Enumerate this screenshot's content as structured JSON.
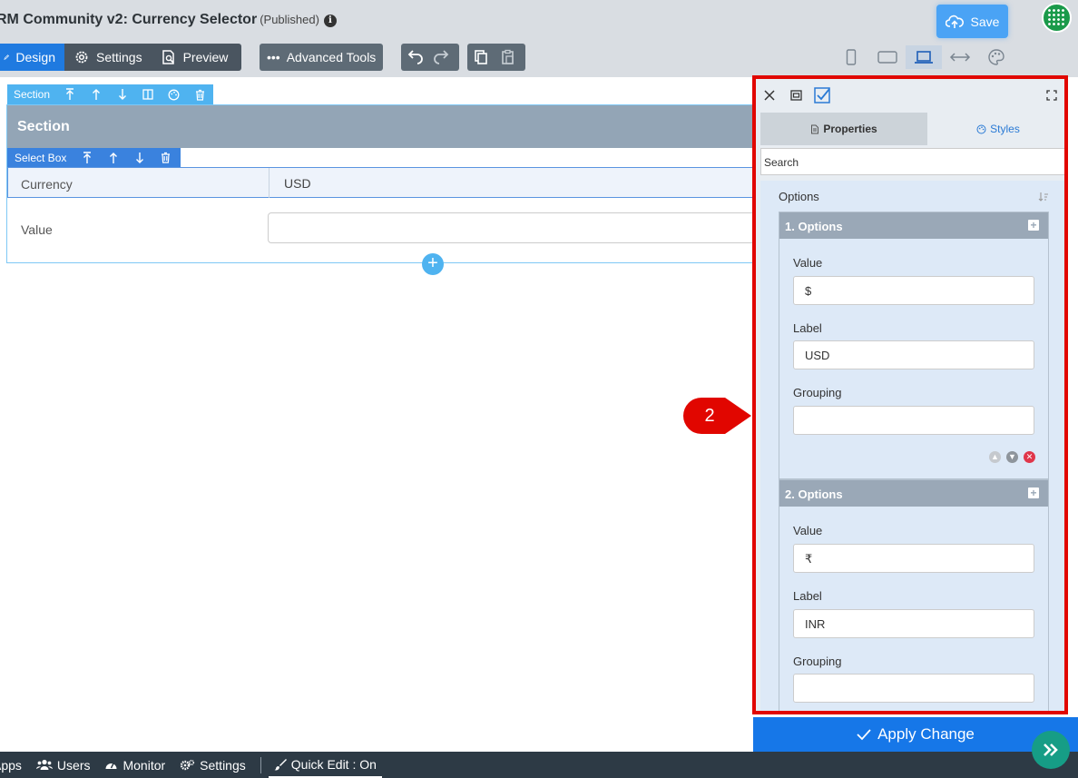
{
  "header": {
    "title": "RM Community v2: Currency Selector",
    "status": "(Published)",
    "info_glyph": "i",
    "save_label": "Save"
  },
  "toolbar": {
    "design": "Design",
    "settings": "Settings",
    "preview": "Preview",
    "advanced_tools": "Advanced Tools"
  },
  "canvas": {
    "section_toolbar_label": "Section",
    "section_title": "Section",
    "selectbox_toolbar_label": "Select Box",
    "currency_label": "Currency",
    "currency_value": "USD",
    "value_label": "Value"
  },
  "annotation": {
    "marker_number": "2",
    "color": "#e10600"
  },
  "panel": {
    "tab_properties": "Properties",
    "tab_styles": "Styles",
    "search_placeholder": "Search",
    "options_title": "Options",
    "options": [
      {
        "header": "1. Options",
        "value_label": "Value",
        "value": "$",
        "label_label": "Label",
        "label": "USD",
        "grouping_label": "Grouping",
        "grouping": ""
      },
      {
        "header": "2. Options",
        "value_label": "Value",
        "value": "₹",
        "label_label": "Label",
        "label": "INR",
        "grouping_label": "Grouping",
        "grouping": ""
      }
    ]
  },
  "apply_label": "Apply Change",
  "footer": {
    "apps": "Apps",
    "users": "Users",
    "monitor": "Monitor",
    "settings": "Settings",
    "quick_edit": "Quick Edit : On"
  },
  "colors": {
    "primary": "#1f7ae0",
    "accent": "#4fb3f0",
    "panel_border": "#e10600",
    "footer": "#2d3a45"
  }
}
